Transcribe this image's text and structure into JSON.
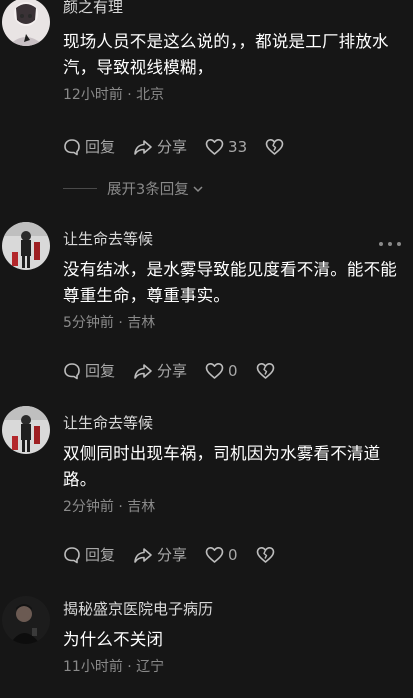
{
  "comments": [
    {
      "author": "颜之有理",
      "text": "现场人员不是这么说的，，都说是工厂排放水汽，导致视线模糊，",
      "meta": "12小时前 · 北京",
      "reply_label": "回复",
      "share_label": "分享",
      "likes": "33"
    },
    {
      "author": "让生命去等候",
      "text": "没有结冰，是水雾导致能见度看不清。能不能尊重生命，尊重事实。",
      "meta": "5分钟前 · 吉林",
      "reply_label": "回复",
      "share_label": "分享",
      "likes": "0"
    },
    {
      "author": "让生命去等候",
      "text": "双侧同时出现车祸，司机因为水雾看不清道路。",
      "meta": "2分钟前 · 吉林",
      "reply_label": "回复",
      "share_label": "分享",
      "likes": "0"
    },
    {
      "author": "揭秘盛京医院电子病历",
      "text": "为什么不关闭",
      "meta": "11小时前 · 辽宁"
    }
  ],
  "expand_replies": {
    "label": "展开3条回复"
  },
  "colors": {
    "background": "#161616",
    "text_primary": "#ffffff",
    "text_secondary": "#8a8a8a"
  },
  "icons": [
    "comment-bubble-icon",
    "share-arrow-icon",
    "heart-icon",
    "broken-heart-icon",
    "more-dots-icon",
    "chevron-down-icon"
  ]
}
